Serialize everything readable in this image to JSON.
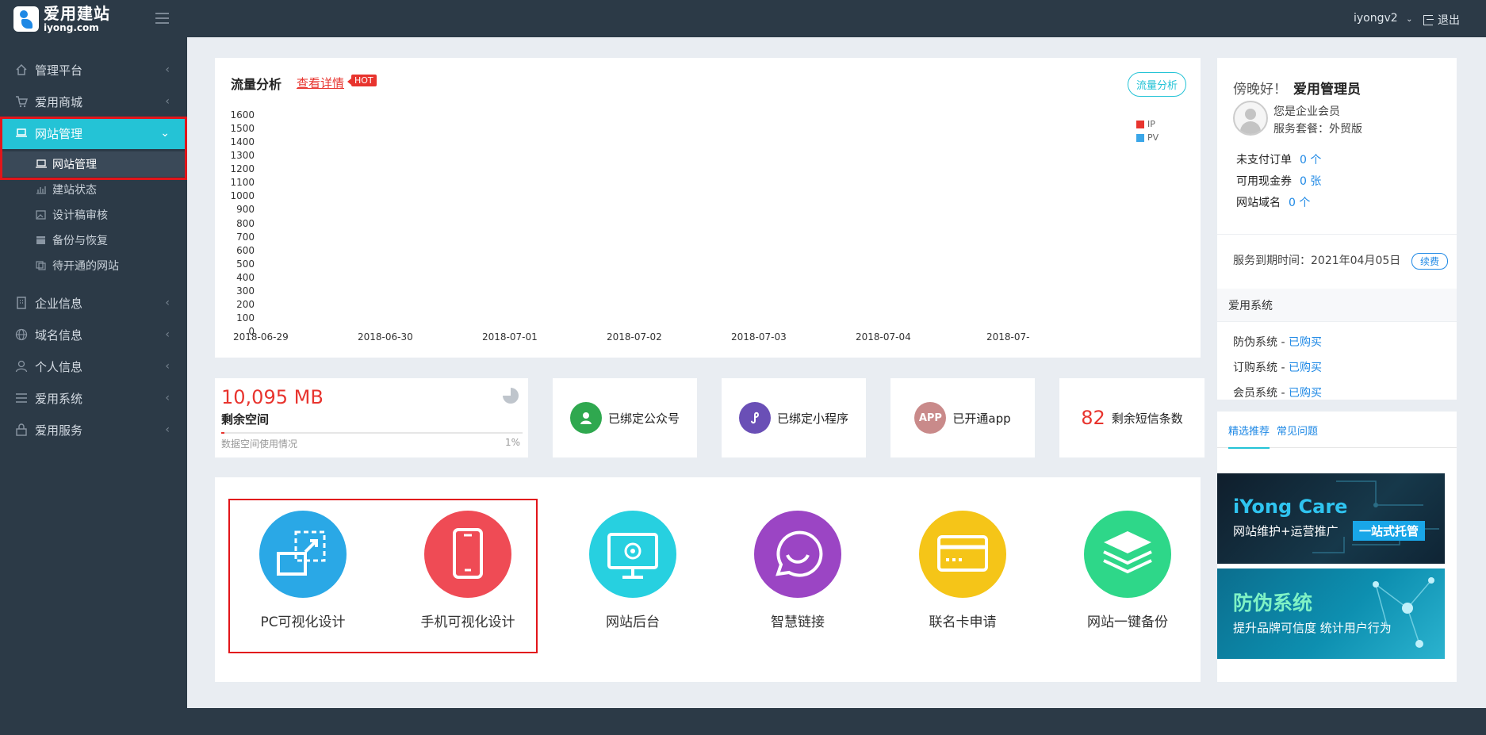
{
  "header": {
    "logo_cn": "爱用建站",
    "logo_en": "iyong.com",
    "username": "iyongv2",
    "logout_label": "退出"
  },
  "sidebar": {
    "items": [
      {
        "label": "管理平台",
        "icon": "home-icon"
      },
      {
        "label": "爱用商城",
        "icon": "cart-icon"
      },
      {
        "label": "网站管理",
        "icon": "laptop-icon",
        "active": true
      },
      {
        "label": "企业信息",
        "icon": "building-icon"
      },
      {
        "label": "域名信息",
        "icon": "globe-icon"
      },
      {
        "label": "个人信息",
        "icon": "user-icon"
      },
      {
        "label": "爱用系统",
        "icon": "menu-icon"
      },
      {
        "label": "爱用服务",
        "icon": "lock-icon"
      }
    ],
    "sub_items": [
      {
        "label": "网站管理",
        "icon": "laptop-icon",
        "current": true
      },
      {
        "label": "建站状态",
        "icon": "bar-chart-icon"
      },
      {
        "label": "设计稿审核",
        "icon": "image-icon"
      },
      {
        "label": "备份与恢复",
        "icon": "archive-icon"
      },
      {
        "label": "待开通的网站",
        "icon": "copy-icon"
      }
    ]
  },
  "chart_card": {
    "title": "流量分析",
    "detail_link": "查看详情",
    "hot_badge": "HOT",
    "flow_button": "流量分析"
  },
  "chart_data": {
    "type": "line",
    "x": [
      "2018-06-29",
      "2018-06-30",
      "2018-07-01",
      "2018-07-02",
      "2018-07-03",
      "2018-07-04",
      "2018-07-"
    ],
    "y_ticks": [
      "1600",
      "1500",
      "1400",
      "1300",
      "1200",
      "1100",
      "1000",
      "900",
      "800",
      "700",
      "600",
      "500",
      "400",
      "300",
      "200",
      "100",
      "0"
    ],
    "ylim": [
      0,
      1600
    ],
    "series": [
      {
        "name": "IP",
        "color": "#e8342e",
        "values": []
      },
      {
        "name": "PV",
        "color": "#3aa6e8",
        "values": []
      }
    ],
    "legend_position": "top-right",
    "grid": false
  },
  "storage": {
    "value": "10,095 MB",
    "label": "剩余空间",
    "bar_label": "数据空间使用情况",
    "percent_text": "1%",
    "percent": 1
  },
  "bindings": [
    {
      "label": "已绑定公众号",
      "icon": "wechat-user-icon",
      "color": "#2fa84f"
    },
    {
      "label": "已绑定小程序",
      "icon": "mini-program-icon",
      "color": "#6a4fb6"
    },
    {
      "label": "已开通app",
      "icon_text": "APP",
      "icon": "app-icon",
      "color": "#c98a8a"
    }
  ],
  "sms": {
    "count": "82",
    "label": "剩余短信条数"
  },
  "tools": [
    {
      "label": "PC可视化设计",
      "color": "#2aa8e6",
      "icon": "pc-design-icon"
    },
    {
      "label": "手机可视化设计",
      "color": "#ef4b55",
      "icon": "mobile-design-icon"
    },
    {
      "label": "网站后台",
      "color": "#27d0e0",
      "icon": "monitor-gear-icon"
    },
    {
      "label": "智慧链接",
      "color": "#9b45c4",
      "icon": "smart-link-icon"
    },
    {
      "label": "联名卡申请",
      "color": "#f5c518",
      "icon": "card-icon"
    },
    {
      "label": "网站一键备份",
      "color": "#2ed789",
      "icon": "layers-icon"
    }
  ],
  "profile": {
    "greeting": "傍晚好！",
    "name": "爱用管理员",
    "member_type": "您是企业会员",
    "package": "服务套餐：外贸版",
    "rows": [
      {
        "label": "未支付订单",
        "value": "0 个"
      },
      {
        "label": "可用现金券",
        "value": "0 张"
      },
      {
        "label": "网站域名",
        "value": "0 个"
      }
    ],
    "expire_label": "服务到期时间：",
    "expire_date": "2021年04月05日",
    "renew_label": "续费"
  },
  "systems": {
    "title": "爱用系统",
    "rows": [
      {
        "label": "防伪系统 - ",
        "status": "已购买"
      },
      {
        "label": "订购系统 - ",
        "status": "已购买"
      },
      {
        "label": "会员系统 - ",
        "status": "已购买"
      }
    ]
  },
  "recommend": {
    "tabs": [
      "精选推荐",
      "常见问题"
    ],
    "banner1": {
      "title": "iYong Care",
      "subtitle": "网站维护+运营推广",
      "badge": "一站式托管"
    },
    "banner2": {
      "title": "防伪系统",
      "subtitle": "提升品牌可信度 统计用户行为"
    }
  }
}
